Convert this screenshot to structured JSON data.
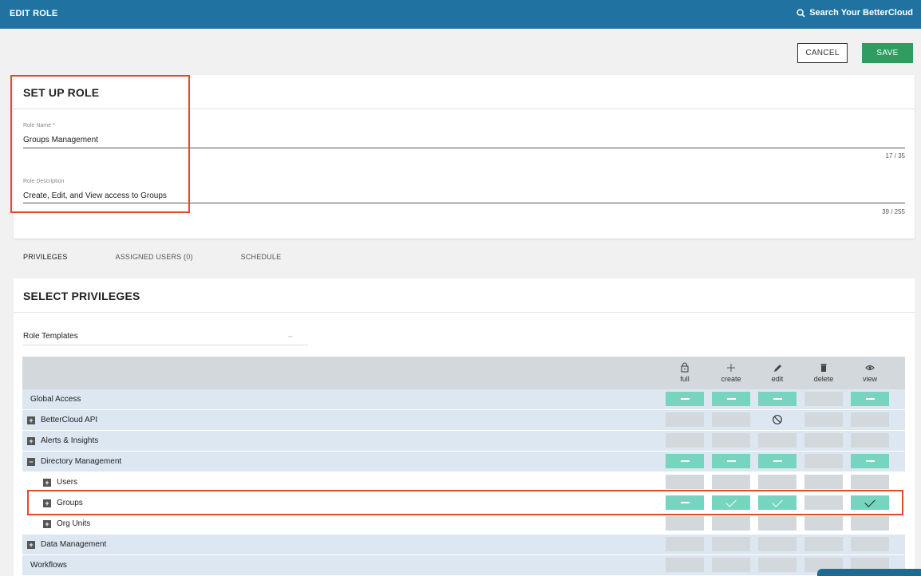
{
  "header": {
    "title": "EDIT ROLE",
    "search_label": "Search Your BetterCloud"
  },
  "actions": {
    "cancel_label": "CANCEL",
    "save_label": "SAVE"
  },
  "setup": {
    "title": "SET UP ROLE",
    "role_name_label": "Role Name *",
    "role_name_value": "Groups Management",
    "role_name_counter": "17 / 35",
    "role_description_label": "Role Description",
    "role_description_value": "Create, Edit, and View access to Groups",
    "role_description_counter": "39 / 255"
  },
  "tabs": [
    {
      "label": "PRIVILEGES",
      "active": true
    },
    {
      "label": "ASSIGNED USERS (0)",
      "active": false
    },
    {
      "label": "SCHEDULE",
      "active": false
    }
  ],
  "privileges": {
    "title": "SELECT PRIVILEGES",
    "role_templates_label": "Role Templates",
    "columns": [
      {
        "key": "full",
        "label": "full",
        "icon": "lock-icon"
      },
      {
        "key": "create",
        "label": "create",
        "icon": "plus-icon"
      },
      {
        "key": "edit",
        "label": "edit",
        "icon": "pencil-icon"
      },
      {
        "key": "delete",
        "label": "delete",
        "icon": "trash-icon"
      },
      {
        "key": "view",
        "label": "view",
        "icon": "eye-icon"
      }
    ],
    "rows": [
      {
        "label": "Global Access",
        "expandable": false,
        "indent": 0,
        "cells": [
          "dash",
          "dash",
          "dash",
          "off",
          "dash"
        ]
      },
      {
        "label": "BetterCloud API",
        "expandable": true,
        "indent": 0,
        "cells": [
          "off",
          "off",
          "blocked",
          "off",
          "off"
        ]
      },
      {
        "label": "Alerts & Insights",
        "expandable": true,
        "indent": 0,
        "cells": [
          "off",
          "off",
          "off",
          "off",
          "off"
        ]
      },
      {
        "label": "Directory Management",
        "expandable": true,
        "expanded": true,
        "indent": 0,
        "cells": [
          "dash",
          "dash",
          "dash",
          "off",
          "dash"
        ]
      },
      {
        "label": "Users",
        "expandable": true,
        "indent": 1,
        "cells": [
          "off",
          "off",
          "off",
          "off",
          "off"
        ]
      },
      {
        "label": "Groups",
        "expandable": true,
        "indent": 1,
        "cells": [
          "dash",
          "check",
          "check",
          "off",
          "check-dark"
        ]
      },
      {
        "label": "Org Units",
        "expandable": true,
        "indent": 1,
        "cells": [
          "off",
          "off",
          "off",
          "off",
          "off"
        ]
      },
      {
        "label": "Data Management",
        "expandable": true,
        "indent": 0,
        "cells": [
          "off",
          "off",
          "off",
          "off",
          "off"
        ]
      },
      {
        "label": "Workflows",
        "expandable": false,
        "indent": 0,
        "cells": [
          "off",
          "off",
          "off",
          "off",
          "off"
        ]
      }
    ]
  },
  "colors": {
    "topbar": "#2073a0",
    "save": "#2e9d5f",
    "enabled_cell": "#76d4bf",
    "disabled_cell": "#d3d8dd",
    "highlight": "#e04a2f"
  }
}
